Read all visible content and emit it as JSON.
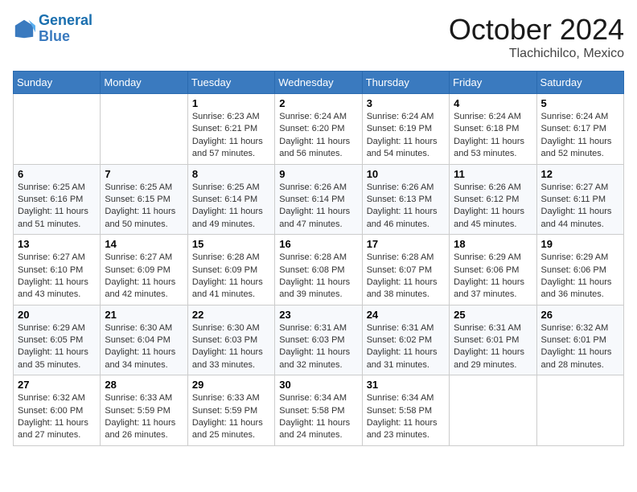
{
  "header": {
    "logo_line1": "General",
    "logo_line2": "Blue",
    "month": "October 2024",
    "location": "Tlachichilco, Mexico"
  },
  "days_of_week": [
    "Sunday",
    "Monday",
    "Tuesday",
    "Wednesday",
    "Thursday",
    "Friday",
    "Saturday"
  ],
  "weeks": [
    [
      {
        "day": "",
        "info": ""
      },
      {
        "day": "",
        "info": ""
      },
      {
        "day": "1",
        "info": "Sunrise: 6:23 AM\nSunset: 6:21 PM\nDaylight: 11 hours and 57 minutes."
      },
      {
        "day": "2",
        "info": "Sunrise: 6:24 AM\nSunset: 6:20 PM\nDaylight: 11 hours and 56 minutes."
      },
      {
        "day": "3",
        "info": "Sunrise: 6:24 AM\nSunset: 6:19 PM\nDaylight: 11 hours and 54 minutes."
      },
      {
        "day": "4",
        "info": "Sunrise: 6:24 AM\nSunset: 6:18 PM\nDaylight: 11 hours and 53 minutes."
      },
      {
        "day": "5",
        "info": "Sunrise: 6:24 AM\nSunset: 6:17 PM\nDaylight: 11 hours and 52 minutes."
      }
    ],
    [
      {
        "day": "6",
        "info": "Sunrise: 6:25 AM\nSunset: 6:16 PM\nDaylight: 11 hours and 51 minutes."
      },
      {
        "day": "7",
        "info": "Sunrise: 6:25 AM\nSunset: 6:15 PM\nDaylight: 11 hours and 50 minutes."
      },
      {
        "day": "8",
        "info": "Sunrise: 6:25 AM\nSunset: 6:14 PM\nDaylight: 11 hours and 49 minutes."
      },
      {
        "day": "9",
        "info": "Sunrise: 6:26 AM\nSunset: 6:14 PM\nDaylight: 11 hours and 47 minutes."
      },
      {
        "day": "10",
        "info": "Sunrise: 6:26 AM\nSunset: 6:13 PM\nDaylight: 11 hours and 46 minutes."
      },
      {
        "day": "11",
        "info": "Sunrise: 6:26 AM\nSunset: 6:12 PM\nDaylight: 11 hours and 45 minutes."
      },
      {
        "day": "12",
        "info": "Sunrise: 6:27 AM\nSunset: 6:11 PM\nDaylight: 11 hours and 44 minutes."
      }
    ],
    [
      {
        "day": "13",
        "info": "Sunrise: 6:27 AM\nSunset: 6:10 PM\nDaylight: 11 hours and 43 minutes."
      },
      {
        "day": "14",
        "info": "Sunrise: 6:27 AM\nSunset: 6:09 PM\nDaylight: 11 hours and 42 minutes."
      },
      {
        "day": "15",
        "info": "Sunrise: 6:28 AM\nSunset: 6:09 PM\nDaylight: 11 hours and 41 minutes."
      },
      {
        "day": "16",
        "info": "Sunrise: 6:28 AM\nSunset: 6:08 PM\nDaylight: 11 hours and 39 minutes."
      },
      {
        "day": "17",
        "info": "Sunrise: 6:28 AM\nSunset: 6:07 PM\nDaylight: 11 hours and 38 minutes."
      },
      {
        "day": "18",
        "info": "Sunrise: 6:29 AM\nSunset: 6:06 PM\nDaylight: 11 hours and 37 minutes."
      },
      {
        "day": "19",
        "info": "Sunrise: 6:29 AM\nSunset: 6:06 PM\nDaylight: 11 hours and 36 minutes."
      }
    ],
    [
      {
        "day": "20",
        "info": "Sunrise: 6:29 AM\nSunset: 6:05 PM\nDaylight: 11 hours and 35 minutes."
      },
      {
        "day": "21",
        "info": "Sunrise: 6:30 AM\nSunset: 6:04 PM\nDaylight: 11 hours and 34 minutes."
      },
      {
        "day": "22",
        "info": "Sunrise: 6:30 AM\nSunset: 6:03 PM\nDaylight: 11 hours and 33 minutes."
      },
      {
        "day": "23",
        "info": "Sunrise: 6:31 AM\nSunset: 6:03 PM\nDaylight: 11 hours and 32 minutes."
      },
      {
        "day": "24",
        "info": "Sunrise: 6:31 AM\nSunset: 6:02 PM\nDaylight: 11 hours and 31 minutes."
      },
      {
        "day": "25",
        "info": "Sunrise: 6:31 AM\nSunset: 6:01 PM\nDaylight: 11 hours and 29 minutes."
      },
      {
        "day": "26",
        "info": "Sunrise: 6:32 AM\nSunset: 6:01 PM\nDaylight: 11 hours and 28 minutes."
      }
    ],
    [
      {
        "day": "27",
        "info": "Sunrise: 6:32 AM\nSunset: 6:00 PM\nDaylight: 11 hours and 27 minutes."
      },
      {
        "day": "28",
        "info": "Sunrise: 6:33 AM\nSunset: 5:59 PM\nDaylight: 11 hours and 26 minutes."
      },
      {
        "day": "29",
        "info": "Sunrise: 6:33 AM\nSunset: 5:59 PM\nDaylight: 11 hours and 25 minutes."
      },
      {
        "day": "30",
        "info": "Sunrise: 6:34 AM\nSunset: 5:58 PM\nDaylight: 11 hours and 24 minutes."
      },
      {
        "day": "31",
        "info": "Sunrise: 6:34 AM\nSunset: 5:58 PM\nDaylight: 11 hours and 23 minutes."
      },
      {
        "day": "",
        "info": ""
      },
      {
        "day": "",
        "info": ""
      }
    ]
  ]
}
